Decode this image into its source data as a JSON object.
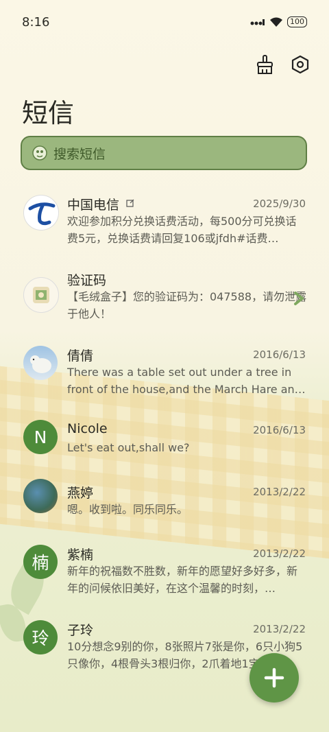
{
  "status_bar": {
    "time": "8:16",
    "battery": "100"
  },
  "header": {
    "title": "短信"
  },
  "search": {
    "placeholder": "搜索短信"
  },
  "messages": [
    {
      "name": "中国电信",
      "date": "2025/9/30",
      "preview": "欢迎参加积分兑换话费活动，每500分可兑换话费5元，兑换话费请回复106或jfdh#话费…",
      "avatar": "china-telecom-logo-icon"
    },
    {
      "name": "验证码",
      "date": "",
      "preview": "【毛绒盒子】您的验证码为：047588，请勿泄露于他人！",
      "avatar": "verification-app-icon"
    },
    {
      "name": "倩倩",
      "date": "2016/6/13",
      "preview": "There was a table set out under a tree in front of the house,and the March Hare an…",
      "avatar": "polar-bear-photo"
    },
    {
      "name": "Nicole",
      "date": "2016/6/13",
      "preview": "Let's eat out,shall we?",
      "avatar_letter": "N"
    },
    {
      "name": "燕婷",
      "date": "2013/2/22",
      "preview": "嗯。收到啦。同乐同乐。",
      "avatar": "landscape-photo"
    },
    {
      "name": "紫楠",
      "date": "2013/2/22",
      "preview": "新年的祝福数不胜数，新年的愿望好多好多，新年的问候依旧美好，在这个温馨的时刻，…",
      "avatar_letter": "楠"
    },
    {
      "name": "子玲",
      "date": "2013/2/22",
      "preview": "10分想念9别的你，8张照片7张是你，6只小狗5只像你，4根骨头3根归你，2爪着地1宝…",
      "avatar_letter": "玲"
    }
  ],
  "colors": {
    "accent": "#5f9546",
    "search_bg": "#9bb77e",
    "background": "#fbf7e6"
  }
}
